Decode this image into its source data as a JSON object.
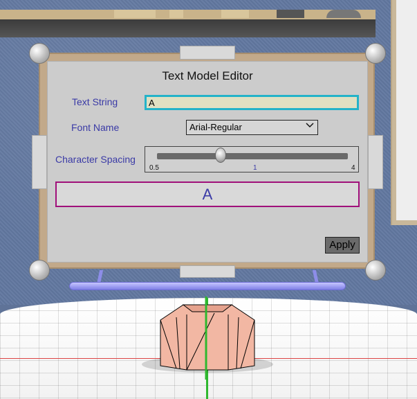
{
  "editor": {
    "title": "Text Model Editor",
    "text_string_label": "Text String",
    "text_string_value": "A",
    "font_name_label": "Font Name",
    "font_name_selected": "Arial-Regular",
    "character_spacing_label": "Character Spacing",
    "spacing": {
      "min_label": "0.5",
      "mid_label": "1",
      "max_label": "4",
      "min": 0.5,
      "max": 4,
      "value": 1
    },
    "preview_text": "A",
    "apply_label": "Apply"
  },
  "colors": {
    "label_text": "#3a3aa6",
    "input_border": "#23b3c9",
    "input_bg": "#e0e0c2",
    "preview_border": "#a0107a",
    "panel_bg": "#cccccc",
    "frame": "#c2a98a",
    "model_fill": "#f2b7a3",
    "floor_axis_red": "#d44444",
    "floor_axis_green": "#2fb82f",
    "rail": "#7f7fe6"
  },
  "icons": {
    "select_chevron": "chevron-down-icon",
    "slider_thumb": "slider-thumb-icon"
  }
}
